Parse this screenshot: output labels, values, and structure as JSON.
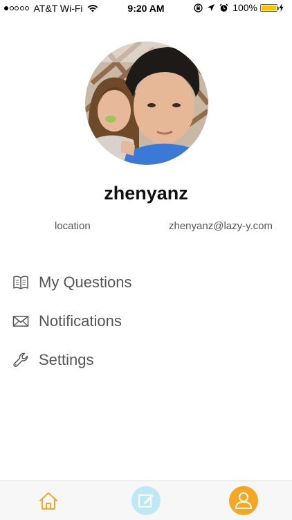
{
  "status_bar": {
    "carrier": "AT&T Wi-Fi",
    "time": "9:20 AM",
    "battery": "100%",
    "signal_bars": 1
  },
  "profile": {
    "username": "zhenyanz",
    "location": "location",
    "email": "zhenyanz@lazy-y.com"
  },
  "menu": [
    {
      "label": "My Questions",
      "icon": "book-icon"
    },
    {
      "label": "Notifications",
      "icon": "envelope-icon"
    },
    {
      "label": "Settings",
      "icon": "wrench-icon"
    }
  ],
  "tab_bar": {
    "tabs": [
      "home-icon",
      "compose-icon",
      "profile-icon"
    ],
    "accent": "#f5a623",
    "compose_color": "#bfe8f7"
  },
  "colors": {
    "battery": "#f7c500",
    "text_secondary": "#555555"
  }
}
